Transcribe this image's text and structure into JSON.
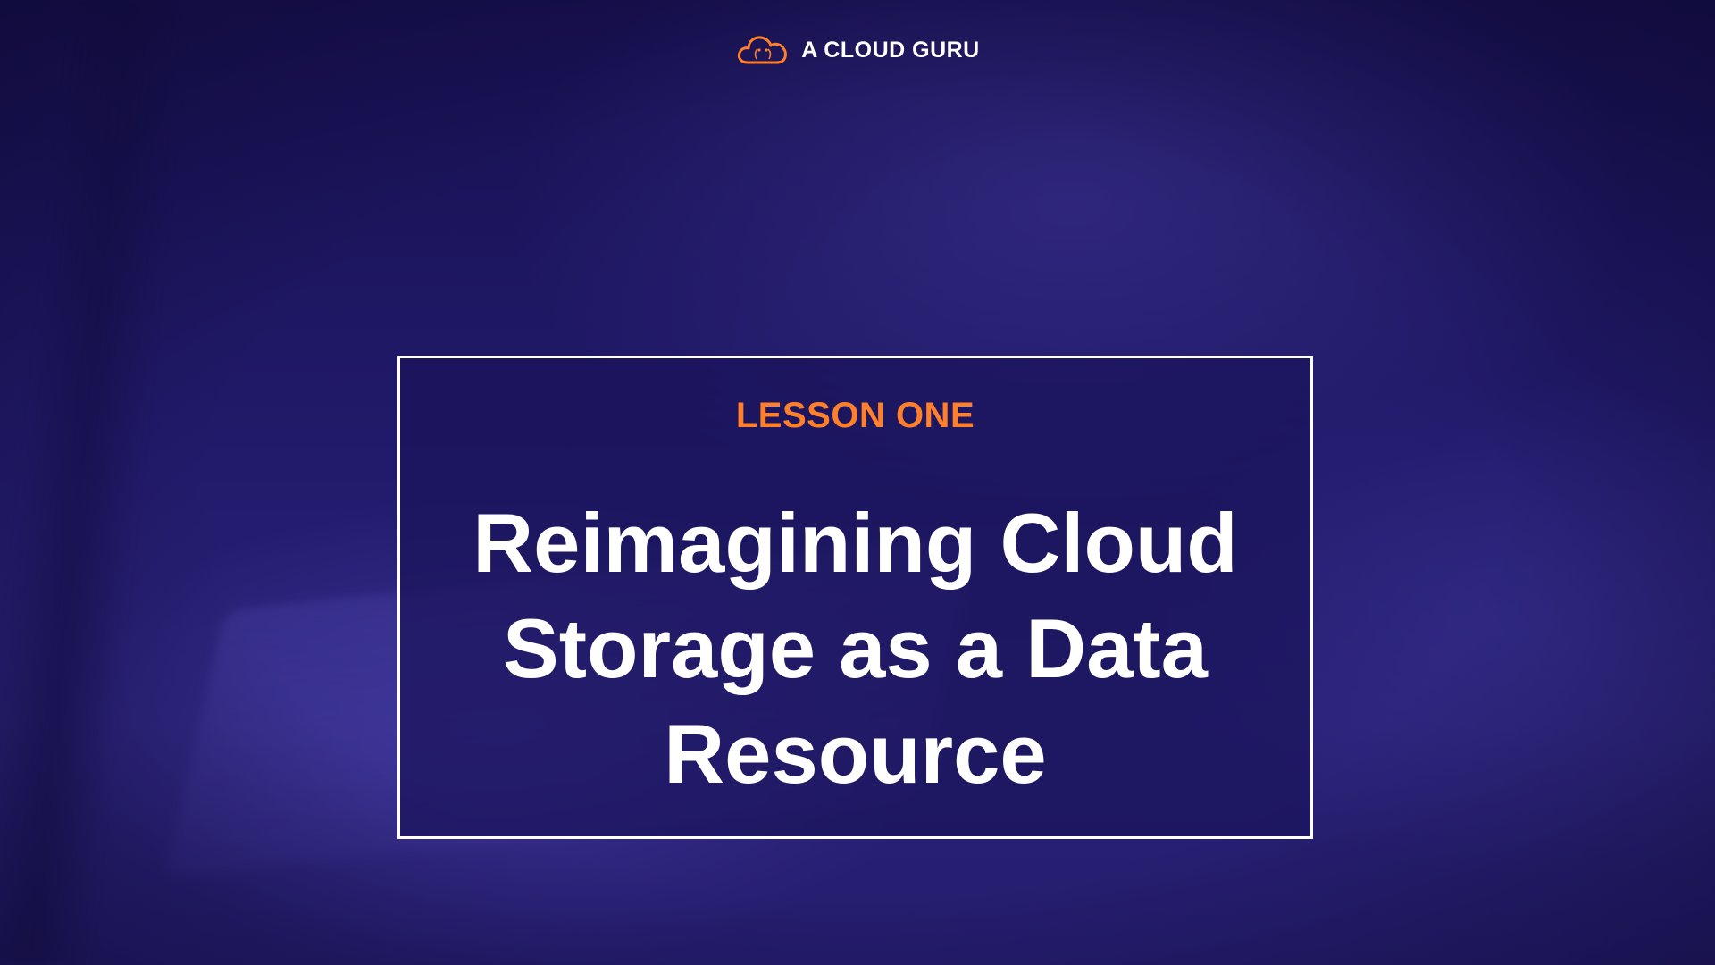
{
  "brand": {
    "name": "A CLOUD GURU",
    "icon": "cloud-logo-icon",
    "accent": "#ff7f2a"
  },
  "lesson": {
    "label": "LESSON ONE",
    "title_lines": [
      "Reimagining Cloud",
      "Storage as a Data",
      "Resource"
    ]
  },
  "colors": {
    "background": "#1c1660",
    "accent": "#ff7f2a",
    "text": "#ffffff",
    "border": "#ffffff"
  }
}
